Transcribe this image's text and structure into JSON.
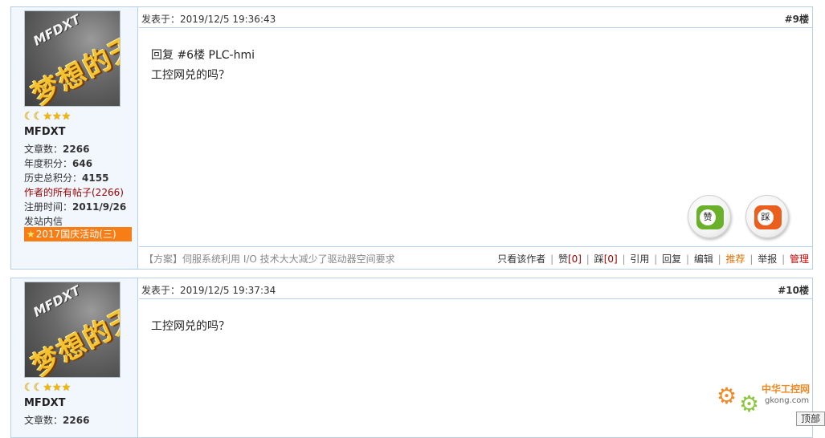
{
  "posts": [
    {
      "author": {
        "name": "MFDXT",
        "avatar_text": "MFDXT",
        "avatar_title": "梦想的天",
        "articles_label": "文章数：",
        "articles": "2266",
        "year_points_label": "年度积分：",
        "year_points": "646",
        "total_points_label": "历史总积分：",
        "total_points": "4155",
        "all_posts_link": "作者的所有帖子(2266)",
        "register_label": "注册时间：",
        "register_date": "2011/9/26",
        "message_link": "发站内信",
        "badge": "2017国庆活动(三)"
      },
      "posted_label": "发表于：",
      "posted_at": "2019/12/5 19:36:43",
      "floor": "#9楼",
      "reply_quote": "回复 #6楼 PLC-hmi",
      "body": "工控网兑的吗？",
      "like_label": "赞",
      "dislike_label": "踩",
      "ad_text": "【方案】伺服系统利用 I/O 技术大大减少了驱动器空间要求",
      "actions": {
        "only_author": "只看该作者",
        "like": "赞",
        "like_count": "[0]",
        "dislike": "踩",
        "dislike_count": "[0]",
        "quote": "引用",
        "reply": "回复",
        "edit": "编辑",
        "recommend": "推荐",
        "report": "举报",
        "manage": "管理",
        "separator": "|"
      }
    },
    {
      "author": {
        "name": "MFDXT",
        "avatar_text": "MFDXT",
        "avatar_title": "梦想的天",
        "articles_label": "文章数：",
        "articles": "2266"
      },
      "posted_label": "发表于：",
      "posted_at": "2019/12/5 19:37:34",
      "floor": "#10楼",
      "body": "工控网兑的吗？"
    }
  ],
  "rank_icons": [
    "moon-icon",
    "moon-icon",
    "star-icon",
    "star-icon",
    "star-icon"
  ],
  "watermark": {
    "name": "中华工控网",
    "url": "gkong.com"
  },
  "back_to_top": "顶部",
  "colors": {
    "border": "#b8d0e6",
    "sidebar_bg": "#f1f7fd",
    "badge": "#f77d16",
    "link_red": "#990000",
    "like": "#6ab02a",
    "dislike": "#ea5f1d"
  }
}
